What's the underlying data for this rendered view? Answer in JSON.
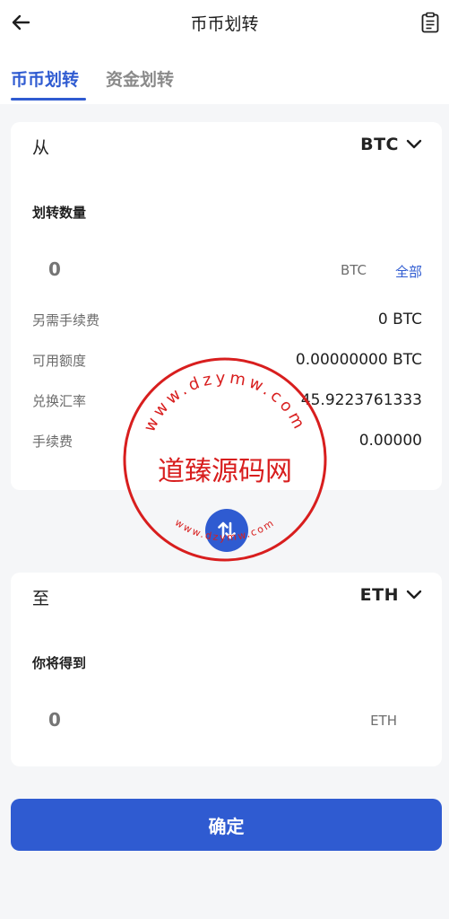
{
  "header": {
    "title": "币币划转",
    "back_icon": "arrow-left-icon",
    "record_icon": "clipboard-list-icon"
  },
  "tabs": [
    {
      "label": "币币划转",
      "active": true
    },
    {
      "label": "资金划转",
      "active": false
    }
  ],
  "from_card": {
    "direction_label": "从",
    "coin": "BTC",
    "amount_label": "划转数量",
    "amount_value": "0",
    "amount_unit": "BTC",
    "all_label": "全部",
    "rows": [
      {
        "label": "另需手续费",
        "value": "0 BTC"
      },
      {
        "label": "可用额度",
        "value": "0.00000000 BTC"
      },
      {
        "label": "兑换汇率",
        "value": "45.9223761333"
      },
      {
        "label": "手续费",
        "value": "0.00000"
      }
    ]
  },
  "to_card": {
    "direction_label": "至",
    "coin": "ETH",
    "receive_label": "你将得到",
    "amount_value": "0",
    "amount_unit": "ETH"
  },
  "swap_icon": "swap-vertical-icon",
  "confirm_label": "确定",
  "watermark": {
    "top_text": "www.dzymw.com",
    "center_text": "道臻源码网",
    "bottom_text": "www.dzymw.com",
    "color": "#d81e1e"
  },
  "colors": {
    "accent": "#2f5bd1",
    "background": "#f5f6f8",
    "card": "#ffffff"
  }
}
